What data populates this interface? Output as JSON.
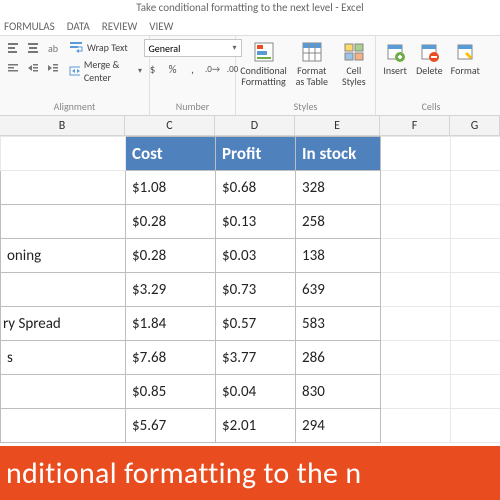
{
  "title": "Take conditional formatting to the next level - Excel",
  "tabs": [
    "FORMULAS",
    "DATA",
    "REVIEW",
    "VIEW"
  ],
  "ribbon": {
    "alignment": {
      "wrap": "Wrap Text",
      "merge": "Merge & Center",
      "label": "Alignment"
    },
    "number": {
      "format": "General",
      "label": "Number"
    },
    "styles": {
      "cond": "Conditional Formatting",
      "table": "Format as Table",
      "cell": "Cell Styles",
      "label": "Styles"
    },
    "cells": {
      "insert": "Insert",
      "delete": "Delete",
      "format": "Format",
      "label": "Cells"
    }
  },
  "columns": [
    "B",
    "C",
    "D",
    "E",
    "F",
    "G"
  ],
  "headers": {
    "c": "Cost",
    "d": "Profit",
    "e": "In stock"
  },
  "rows": [
    {
      "b": "",
      "c": "$1.08",
      "d": "$0.68",
      "e": "328"
    },
    {
      "b": "",
      "c": "$0.28",
      "d": "$0.13",
      "e": "258"
    },
    {
      "b": "oning",
      "c": "$0.28",
      "d": "$0.03",
      "e": "138"
    },
    {
      "b": "",
      "c": "$3.29",
      "d": "$0.73",
      "e": "639"
    },
    {
      "b": "ry Spread",
      "c": "$1.84",
      "d": "$0.57",
      "e": "583"
    },
    {
      "b": "s",
      "c": "$7.68",
      "d": "$3.77",
      "e": "286"
    },
    {
      "b": "",
      "c": "$0.85",
      "d": "$0.04",
      "e": "830"
    },
    {
      "b": "",
      "c": "$5.67",
      "d": "$2.01",
      "e": "294"
    }
  ],
  "banner": "nditional formatting to the n"
}
